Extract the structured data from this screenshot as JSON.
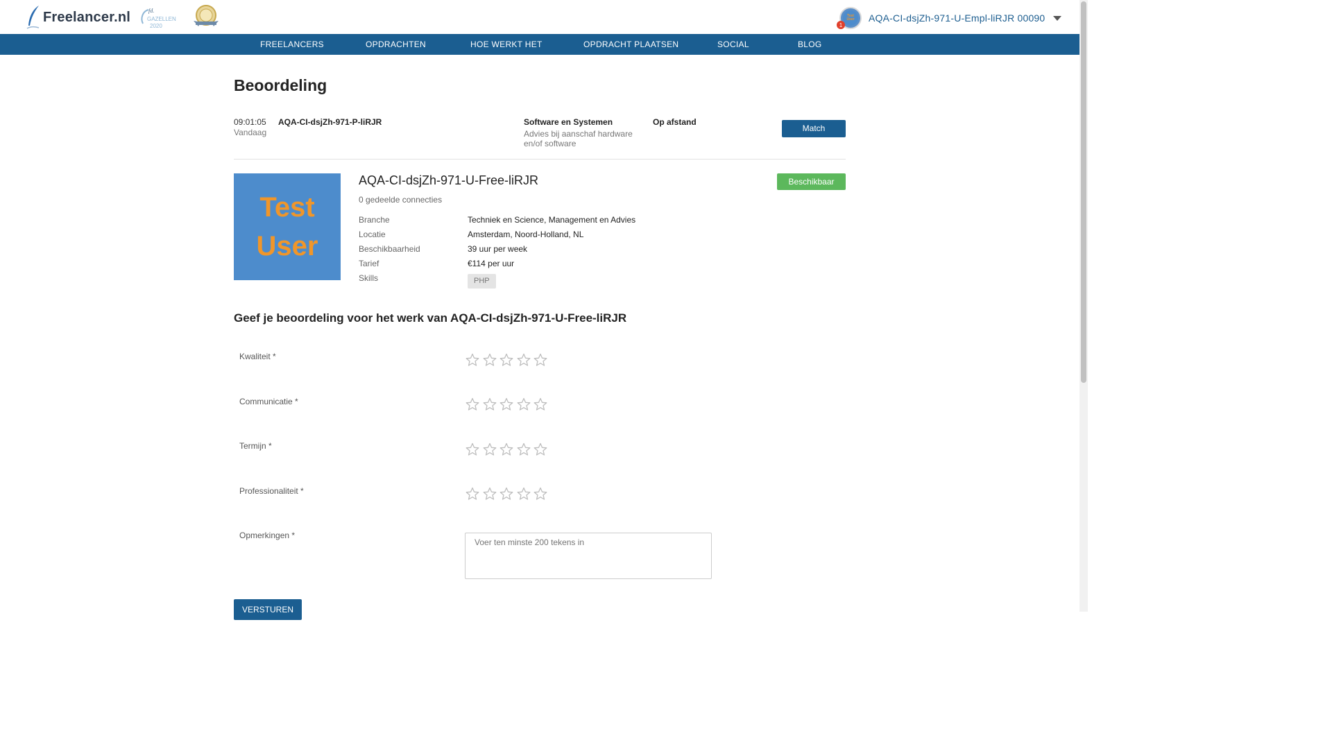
{
  "header": {
    "brand": "Freelancer.nl",
    "award1_text": "GAZELLEN",
    "award1_year": "2020",
    "user_name": "AQA-CI-dsjZh-971-U-Empl-liRJR 00090",
    "notification_count": "1"
  },
  "nav": {
    "items": [
      "FREELANCERS",
      "OPDRACHTEN",
      "HOE WERKT HET",
      "OPDRACHT PLAATSEN",
      "SOCIAL",
      "BLOG"
    ]
  },
  "page": {
    "title": "Beoordeling"
  },
  "job": {
    "time": "09:01:05",
    "day": "Vandaag",
    "title": "AQA-CI-dsjZh-971-P-liRJR",
    "category": "Software en Systemen",
    "subcategory": "Advies bij aanschaf hardware en/of software",
    "location_type": "Op afstand",
    "match_label": "Match"
  },
  "profile": {
    "photo_line1": "Test",
    "photo_line2": "User",
    "name": "AQA-CI-dsjZh-971-U-Free-liRJR",
    "connections": "0 gedeelde connecties",
    "availability_label": "Beschikbaar",
    "details": [
      {
        "label": "Branche",
        "value": "Techniek en Science, Management en Advies"
      },
      {
        "label": "Locatie",
        "value": "Amsterdam, Noord-Holland, NL"
      },
      {
        "label": "Beschikbaarheid",
        "value": "39 uur per week"
      },
      {
        "label": "Tarief",
        "value": "€114 per uur"
      },
      {
        "label": "Skills",
        "value": ""
      }
    ],
    "skills": [
      "PHP"
    ]
  },
  "review": {
    "title": "Geef je beoordeling voor het werk van AQA-CI-dsjZh-971-U-Free-liRJR",
    "criteria": [
      {
        "label": "Kwaliteit *",
        "rating": 0,
        "max": 5
      },
      {
        "label": "Communicatie *",
        "rating": 0,
        "max": 5
      },
      {
        "label": "Termijn *",
        "rating": 0,
        "max": 5
      },
      {
        "label": "Professionaliteit *",
        "rating": 0,
        "max": 5
      }
    ],
    "remarks_label": "Opmerkingen *",
    "remarks_placeholder": "Voer ten minste 200 tekens in",
    "remarks_value": "",
    "submit_label": "VERSTUREN"
  },
  "colors": {
    "primary": "#1b5e91",
    "success": "#5cb85c",
    "star_empty": "#bdbdbd"
  }
}
